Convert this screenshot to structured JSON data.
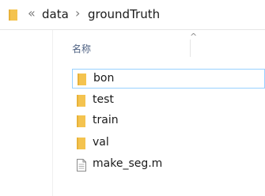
{
  "breadcrumb": {
    "overflow": "«",
    "items": [
      "data",
      "groundTruth"
    ],
    "separator": "›"
  },
  "list": {
    "column_name": "名称",
    "sort": "ascending",
    "items": [
      {
        "name": "bon",
        "icon": "folder-icon",
        "selected": true
      },
      {
        "name": "test",
        "icon": "folder-icon"
      },
      {
        "name": "train",
        "icon": "folder-icon"
      },
      {
        "name": "val",
        "icon": "folder-icon"
      },
      {
        "name": "make_seg.m",
        "icon": "file-icon"
      }
    ]
  },
  "colors": {
    "folder": "#f4c34f",
    "selection_border": "#99d1ff",
    "header_text": "#4d6082"
  }
}
